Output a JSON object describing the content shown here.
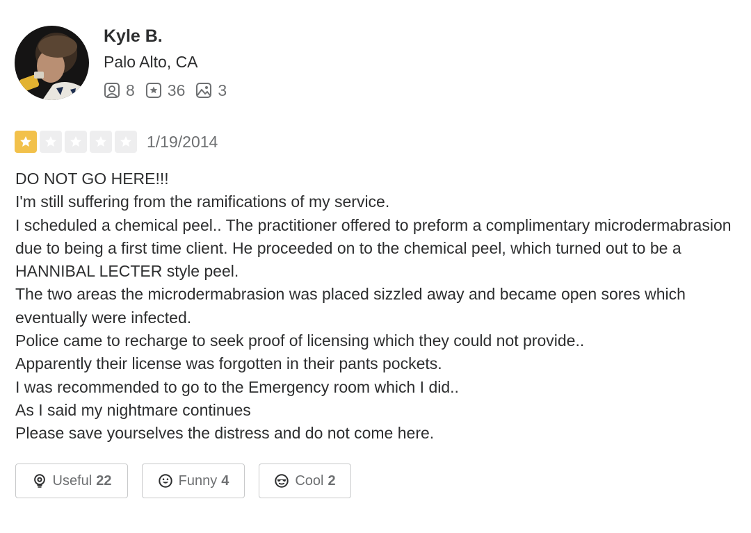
{
  "user": {
    "name": "Kyle B.",
    "location": "Palo Alto, CA",
    "friends_count": "8",
    "reviews_count": "36",
    "photos_count": "3"
  },
  "review": {
    "rating": 1,
    "max_rating": 5,
    "date": "1/19/2014",
    "lines": [
      "DO NOT GO HERE!!!",
      "I'm still suffering from the ramifications of my service.",
      "I scheduled a chemical peel.. The practitioner offered to preform a complimentary microdermabrasion due to being a first time client. He proceeded on to the chemical peel, which turned out to be a HANNIBAL LECTER style peel.",
      "The two areas the microdermabrasion was placed sizzled away and became open sores which eventually were infected.",
      "Police came to recharge to seek proof of licensing which they could not provide..",
      "Apparently their license was forgotten in their pants pockets.",
      "I was recommended to go to the Emergency room which I did..",
      "As I said my nightmare continues",
      "Please save yourselves the distress and do not come here."
    ]
  },
  "reactions": {
    "useful_label": "Useful",
    "useful_count": "22",
    "funny_label": "Funny",
    "funny_count": "4",
    "cool_label": "Cool",
    "cool_count": "2"
  },
  "colors": {
    "star_filled": "#f2c14b",
    "star_empty": "#eeeeef",
    "text_primary": "#2d2e2f",
    "text_secondary": "#6e7072",
    "button_border": "#c8c9ca"
  },
  "icons": {
    "friends": "friends-icon",
    "reviews": "review-star-icon",
    "photos": "photo-icon",
    "useful": "lightbulb-icon",
    "funny": "smile-icon",
    "cool": "sunglasses-icon"
  }
}
